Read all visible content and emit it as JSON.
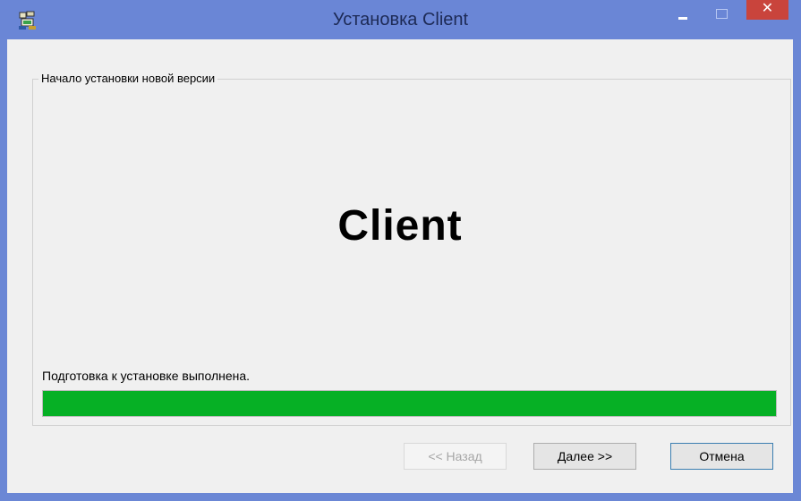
{
  "window": {
    "title": "Установка Client"
  },
  "titlebar": {
    "close_glyph": "✕"
  },
  "wizard": {
    "group_title": "Начало установки новой версии",
    "logo_text": "Client",
    "status_text": "Подготовка к установке выполнена.",
    "progress_fraction": 1.0,
    "progress_color": "#06b025"
  },
  "buttons": {
    "back_label": "<< Назад",
    "next_label": "Далее >>",
    "cancel_label": "Отмена"
  },
  "colors": {
    "titlebar": "#6a86d6",
    "close_button": "#c9443c",
    "client_bg": "#f0f0f0"
  }
}
